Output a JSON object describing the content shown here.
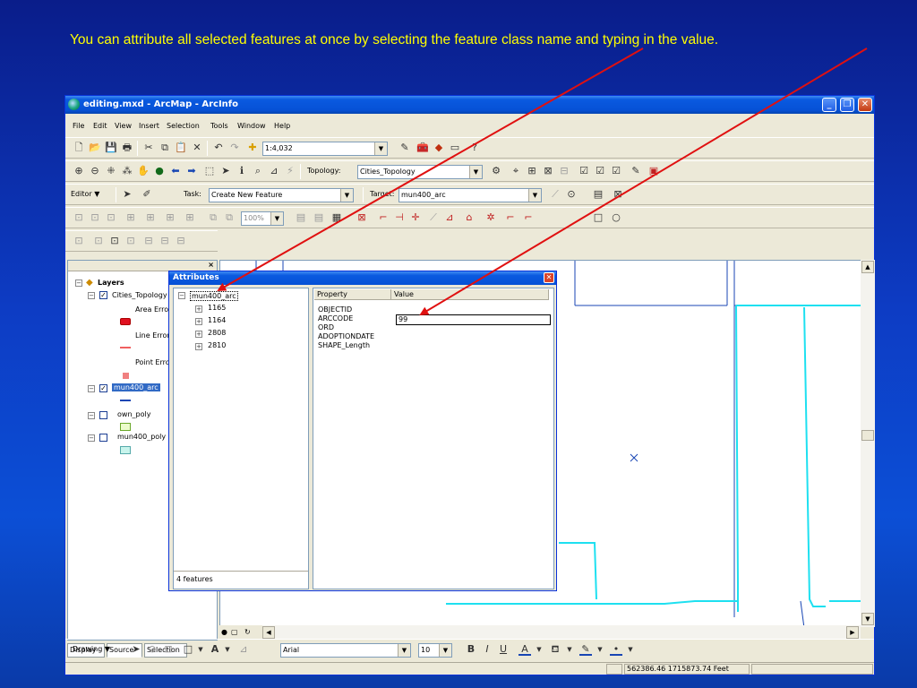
{
  "slide": {
    "caption": "You can attribute all selected features at once by selecting the feature class name and typing in the value."
  },
  "window": {
    "title": "editing.mxd - ArcMap - ArcInfo",
    "min_label": "_",
    "max_label": "❐",
    "close_label": "✕"
  },
  "menu": [
    "File",
    "Edit",
    "View",
    "Insert",
    "Selection",
    "Tools",
    "Window",
    "Help"
  ],
  "standard_toolbar": {
    "scale": "1:4,032"
  },
  "topology_toolbar": {
    "label": "Topology:",
    "value": "Cities_Topology"
  },
  "editor_toolbar": {
    "editor_label": "Editor ▼",
    "task_label": "Task:",
    "task_value": "Create New Feature",
    "target_label": "Target:",
    "target_value": "mun400_arc"
  },
  "advanced_toolbar": {
    "zoom_value": "100%"
  },
  "toc": {
    "layers_label": "Layers",
    "items": [
      {
        "label": "Cities_Topology",
        "checked": true
      },
      {
        "label": "Area Errors"
      },
      {
        "label": "Line Errors"
      },
      {
        "label": "Point Errors"
      },
      {
        "label": "mun400_arc",
        "checked": true
      },
      {
        "label": "own_poly",
        "checked": false
      },
      {
        "label": "mun400_poly",
        "checked": false
      }
    ],
    "tabs": [
      "Display",
      "Source",
      "Selection"
    ]
  },
  "attributes_dialog": {
    "title": "Attributes",
    "close_label": "✕",
    "tree_root": "mun400_arc",
    "tree_children": [
      "1165",
      "1164",
      "2808",
      "2810"
    ],
    "features_count": "4 features",
    "col_property": "Property",
    "col_value": "Value",
    "properties": [
      "OBJECTID",
      "ARCCODE",
      "ORD",
      "ADOPTIONDATE",
      "SHAPE_Length"
    ],
    "arccode_value": "99"
  },
  "drawing_toolbar": {
    "drawing_label": "Drawing ▼",
    "font": "Arial",
    "size": "10",
    "bold": "B",
    "italic": "I",
    "underline": "U"
  },
  "status": {
    "coords": "562386.46  1715873.74 Feet"
  },
  "colors": {
    "slide_bg": "#0c4fd6",
    "caption": "#ffff00",
    "arrow": "#e01010",
    "map_line": "#1ee0f0",
    "selection_highlight": "#316ac5"
  }
}
